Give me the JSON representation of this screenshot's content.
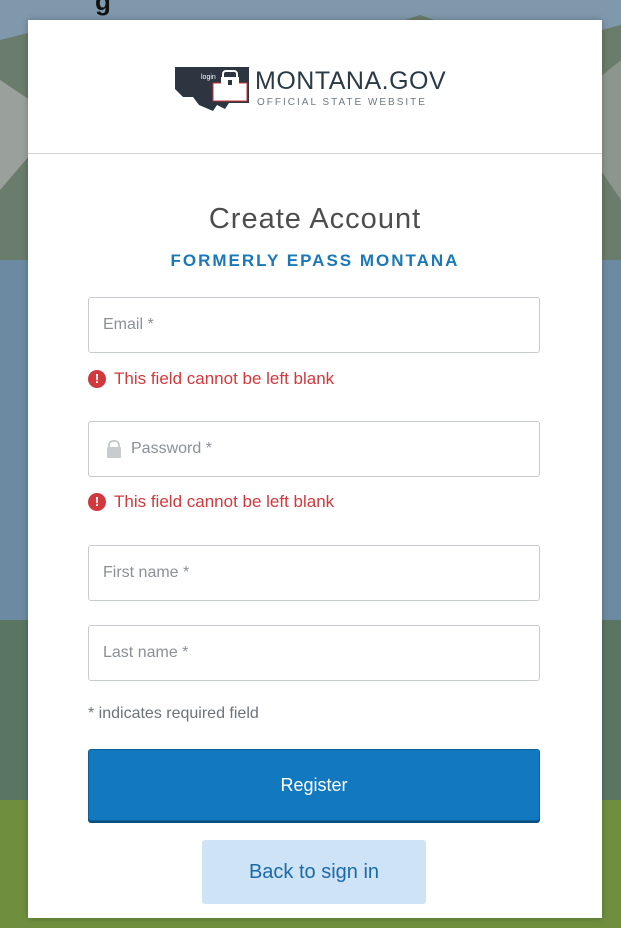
{
  "page": {
    "top_fragment_text": "g"
  },
  "logo": {
    "main_text": "MONTANA.GOV",
    "sub_text": "OFFICIAL STATE WEBSITE",
    "badge_text": "login"
  },
  "form": {
    "title": "Create Account",
    "subtitle": "FORMERLY EPASS MONTANA",
    "email": {
      "placeholder": "Email *",
      "value": "",
      "error": "This field cannot be left blank"
    },
    "password": {
      "placeholder": "Password *",
      "value": "",
      "error": "This field cannot be left blank"
    },
    "first_name": {
      "placeholder": "First name *",
      "value": ""
    },
    "last_name": {
      "placeholder": "Last name *",
      "value": ""
    },
    "required_note": "* indicates required field",
    "register_label": "Register",
    "back_label": "Back to sign in"
  },
  "colors": {
    "accent": "#1279c0",
    "error": "#d0393d",
    "subtitle": "#1b78b8"
  },
  "icons": {
    "error": "exclamation-circle-icon",
    "password": "lock-icon",
    "logo": "montana-state-icon"
  }
}
